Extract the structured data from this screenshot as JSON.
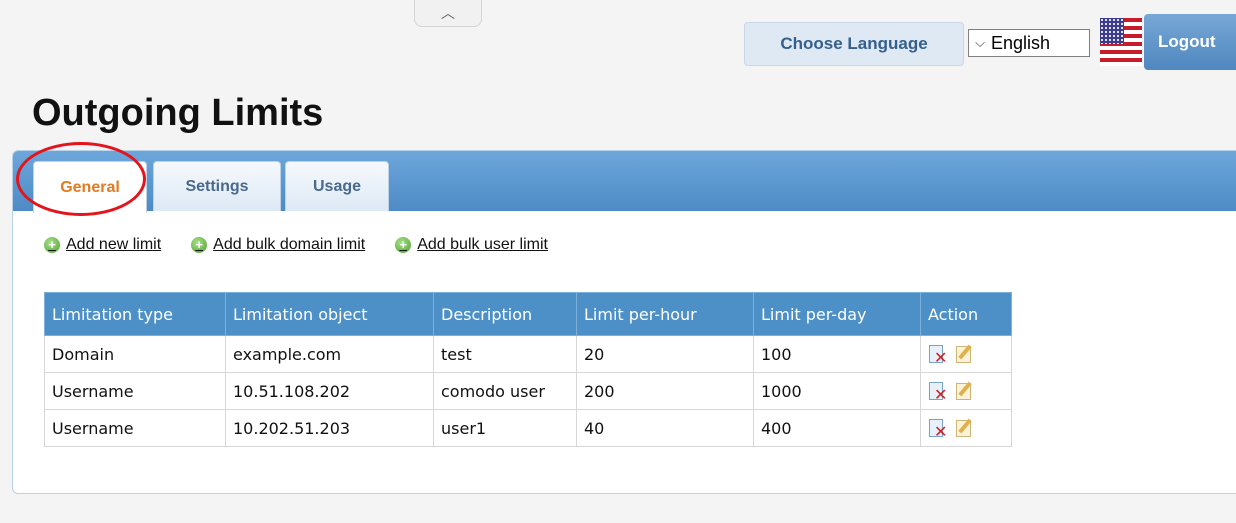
{
  "header": {
    "choose_language": "Choose Language",
    "language_selected": "English",
    "logout": "Logout",
    "flag_icon": "us-flag-icon"
  },
  "page": {
    "title": "Outgoing Limits"
  },
  "tabs": [
    {
      "label": "General",
      "active": true
    },
    {
      "label": "Settings",
      "active": false
    },
    {
      "label": "Usage",
      "active": false
    }
  ],
  "actions": [
    {
      "label": "Add new limit",
      "icon": "add-icon"
    },
    {
      "label": "Add bulk domain limit",
      "icon": "add-icon"
    },
    {
      "label": "Add bulk user limit",
      "icon": "add-icon"
    }
  ],
  "table": {
    "columns": [
      "Limitation type",
      "Limitation object",
      "Description",
      "Limit per-hour",
      "Limit per-day",
      "Action"
    ],
    "rows": [
      [
        "Domain",
        "example.com",
        "test",
        "20",
        "100"
      ],
      [
        "Username",
        "10.51.108.202",
        "comodo user",
        "200",
        "1000"
      ],
      [
        "Username",
        "10.202.51.203",
        "user1",
        "40",
        "400"
      ]
    ],
    "row_action_icons": [
      "delete-icon",
      "edit-icon"
    ]
  },
  "colors": {
    "tab_bar": "#5b98d0",
    "active_tab_text": "#e07b21",
    "table_header": "#4d90c8",
    "highlight_circle": "#e3141b"
  }
}
